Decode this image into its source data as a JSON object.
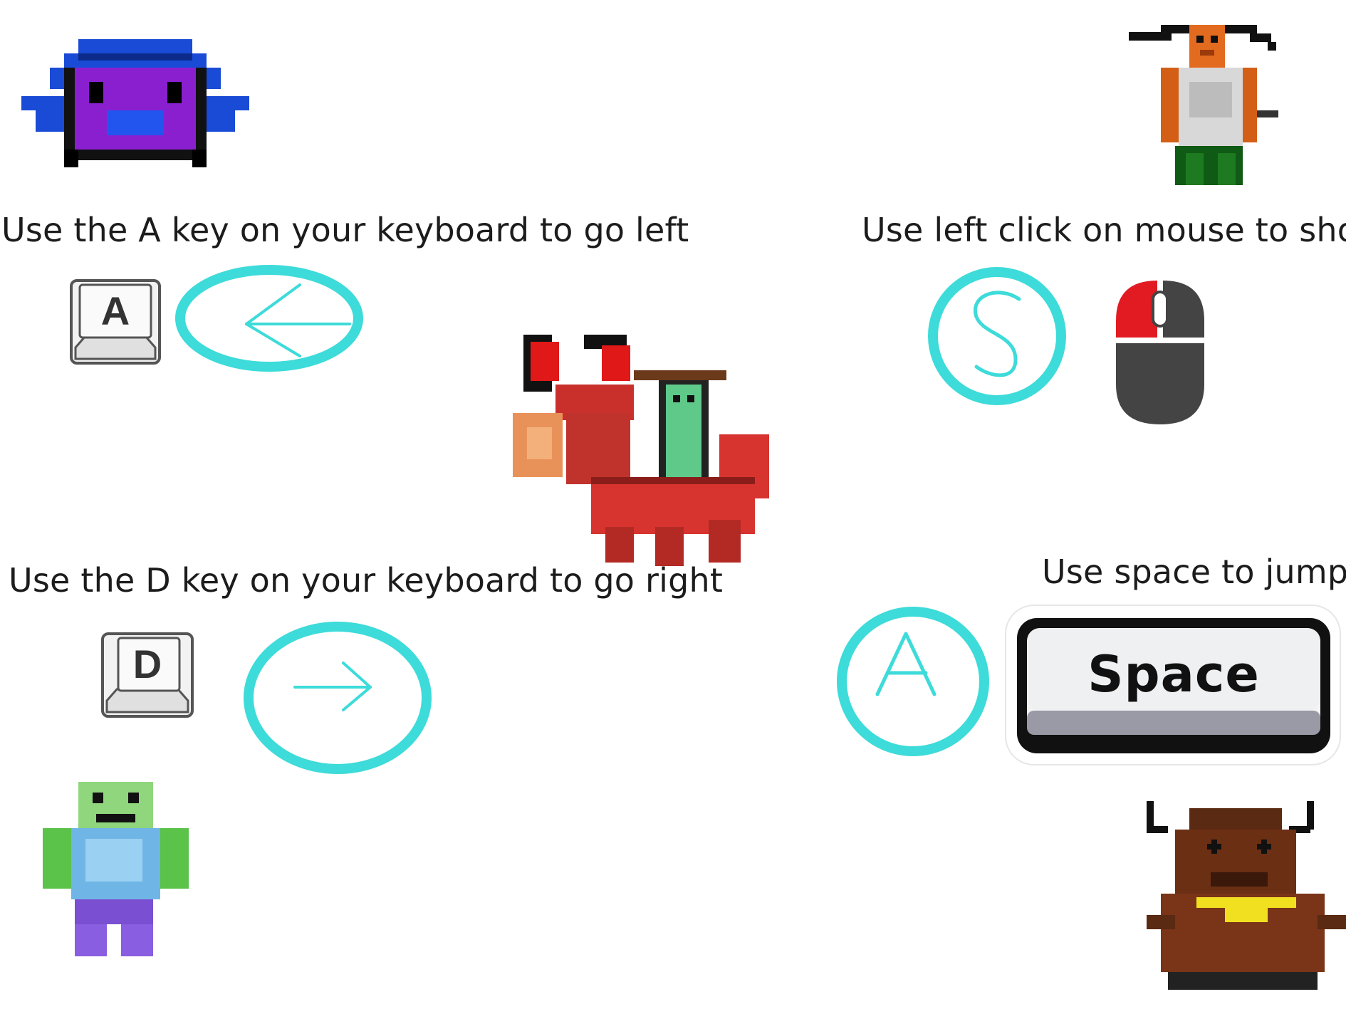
{
  "instructions": {
    "left": "Use the A key on your keyboard to go left",
    "right": "Use the D key on your keyboard to go right",
    "shoot": "Use left click on mouse to shoot",
    "jump": "Use space to jump"
  },
  "keys": {
    "a": "A",
    "d": "D",
    "space": "Space",
    "gesture_shoot": "S",
    "gesture_jump": "A"
  },
  "colors": {
    "gesture_circle": "#3ddbd9",
    "mouse_button": "#e21b22",
    "mouse_body": "#444444"
  },
  "icons": {
    "left_gesture": "left-arrow-gesture-icon",
    "right_gesture": "right-arrow-gesture-icon",
    "shoot_gesture": "s-gesture-icon",
    "jump_gesture": "a-gesture-icon",
    "mouse": "mouse-icon"
  }
}
